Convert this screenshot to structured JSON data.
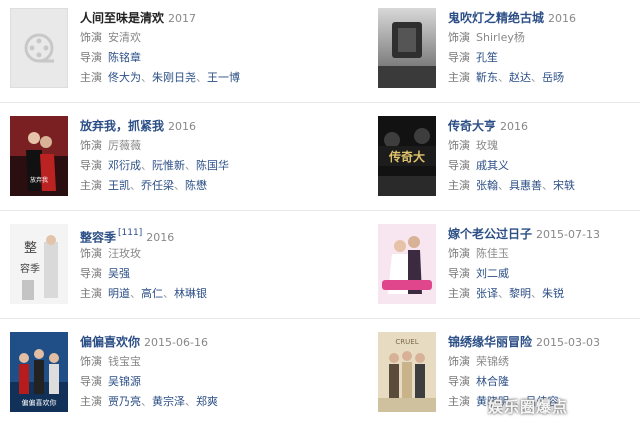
{
  "labels": {
    "role": "饰演",
    "director": "导演",
    "cast": "主演"
  },
  "movies": [
    {
      "title": "人间至味是清欢",
      "year": "2017",
      "role": "安清欢",
      "director": [
        "陈铭章"
      ],
      "cast": [
        "佟大为",
        "朱刚日尧",
        "王一博"
      ],
      "poster": "placeholder-film-icon"
    },
    {
      "title": "鬼吹灯之精绝古城",
      "year": "2016",
      "role": "Shirley杨",
      "director": [
        "孔笙"
      ],
      "cast": [
        "靳东",
        "赵达",
        "岳旸"
      ],
      "poster": "dark-stone"
    },
    {
      "title": "放弃我，抓紧我",
      "year": "2016",
      "role": "厉薇薇",
      "director": [
        "邓衍成",
        "阮惟新",
        "陈国华"
      ],
      "cast": [
        "王凯",
        "乔任梁",
        "陈懋"
      ],
      "poster": "red-couple"
    },
    {
      "title": "传奇大亨",
      "year": "2016",
      "role": "玫瑰",
      "director": [
        "戚其义"
      ],
      "cast": [
        "张翰",
        "具惠善",
        "宋轶"
      ],
      "poster": "dark-gold",
      "poster_text": "传奇大"
    },
    {
      "title": "整容季",
      "sup": "[111]",
      "year": "2016",
      "role": "汪玫玫",
      "director": [
        "吴强"
      ],
      "cast": [
        "明道",
        "高仁",
        "林琳银"
      ],
      "poster": "white-fashion",
      "poster_text": "整容季"
    },
    {
      "title": "嫁个老公过日子",
      "year": "2015-07-13",
      "role": "陈佳玉",
      "director": [
        "刘二威"
      ],
      "cast": [
        "张译",
        "黎明",
        "朱锐"
      ],
      "poster": "pink-wedding"
    },
    {
      "title": "偏偏喜欢你",
      "year": "2015-06-16",
      "role": "钱宝宝",
      "director": [
        "吴锦源"
      ],
      "cast": [
        "贾乃亮",
        "黄宗泽",
        "郑爽"
      ],
      "poster": "blue-group",
      "poster_text": "偏偏喜欢你"
    },
    {
      "title": "锦绣缘华丽冒险",
      "year": "2015-03-03",
      "role": "荣锦绣",
      "director": [
        "林合隆"
      ],
      "cast": [
        "黄晓明",
        "",
        "吕佳容"
      ],
      "poster": "beige-group",
      "poster_text": "CRUEL"
    }
  ],
  "watermark": "娱乐圈爆点"
}
